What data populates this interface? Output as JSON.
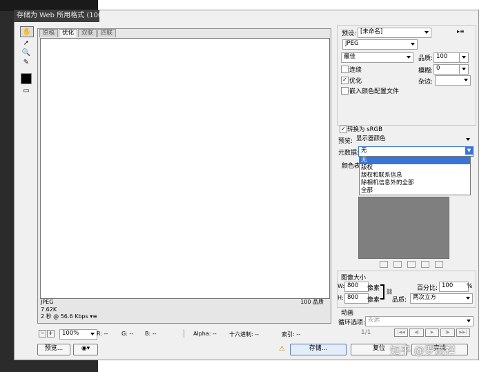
{
  "window": {
    "title": "存储为 Web 所用格式 (100%)"
  },
  "canvas_tabs": [
    {
      "label": "原稿",
      "active": false
    },
    {
      "label": "优化",
      "active": true
    },
    {
      "label": "双联",
      "active": false
    },
    {
      "label": "四联",
      "active": false
    }
  ],
  "image_info": {
    "format": "JPEG",
    "size": "7.62K",
    "time": "2 秒 @ 56.6 Kbps",
    "quality": "100 品质"
  },
  "status_bar": {
    "zoom": "100%",
    "r": "R: --",
    "g": "G: --",
    "b": "B: --",
    "alpha": "Alpha: --",
    "hex": "十六进制: --",
    "index": "索引: --"
  },
  "settings": {
    "preset_label": "预设:",
    "preset_value": "[未命名]",
    "format_value": "JPEG",
    "quality_level": "最佳",
    "quality_label": "品质:",
    "quality_value": "100",
    "progressive_label": "连续",
    "blur_label": "模糊:",
    "blur_value": "0",
    "optimized_label": "优化",
    "matte_label": "杂边:",
    "embed_profile_label": "嵌入颜色配置文件",
    "convert_srgb_label": "转换为 sRGB",
    "preview_label": "预览:",
    "preview_value": "显示器颜色",
    "metadata_label": "元数据:",
    "metadata_value": "无",
    "color_table_label": "颜色表"
  },
  "metadata_menu": [
    "无",
    "版权",
    "版权和联系信息",
    "除相机信息外的全部",
    "全部"
  ],
  "image_size": {
    "title": "图像大小",
    "w_label": "W:",
    "w_value": "800",
    "h_label": "H:",
    "h_value": "800",
    "unit": "像素",
    "percent_label": "百分比:",
    "percent_value": "100",
    "percent_unit": "%",
    "quality_label": "品质:",
    "quality_value": "两次立方"
  },
  "animation": {
    "title": "动画",
    "loop_label": "循环选项:",
    "loop_value": "永远",
    "frame": "1/1"
  },
  "buttons": {
    "preview": "预览...",
    "save": "存储...",
    "reset": "复位",
    "done": "完成"
  },
  "watermark": "知乎 @罗志祥"
}
